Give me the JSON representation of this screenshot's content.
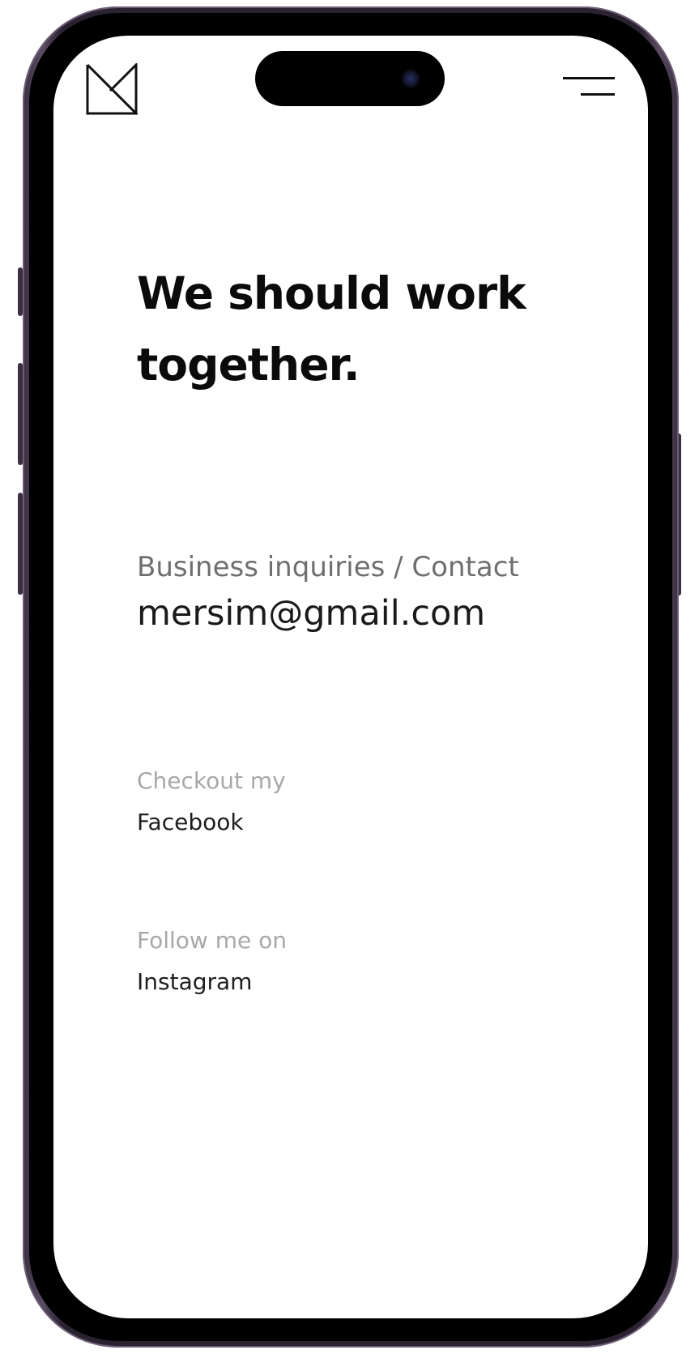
{
  "header": {
    "logo_icon": "monogram-m-icon",
    "menu_icon": "hamburger-menu-icon"
  },
  "hero": {
    "headline_line1": "We should work",
    "headline_line2": "together."
  },
  "contact": {
    "label": "Business inquiries / Contact",
    "email": "mersim@gmail.com"
  },
  "social": {
    "facebook_label": "Checkout my",
    "facebook_link": "Facebook",
    "instagram_label": "Follow me on",
    "instagram_link": "Instagram"
  },
  "colors": {
    "frame": "#2a2230",
    "bezel": "#000000",
    "text_primary": "#0b0b0b",
    "text_secondary": "#6f6f6f",
    "text_muted": "#a8a8a8"
  }
}
